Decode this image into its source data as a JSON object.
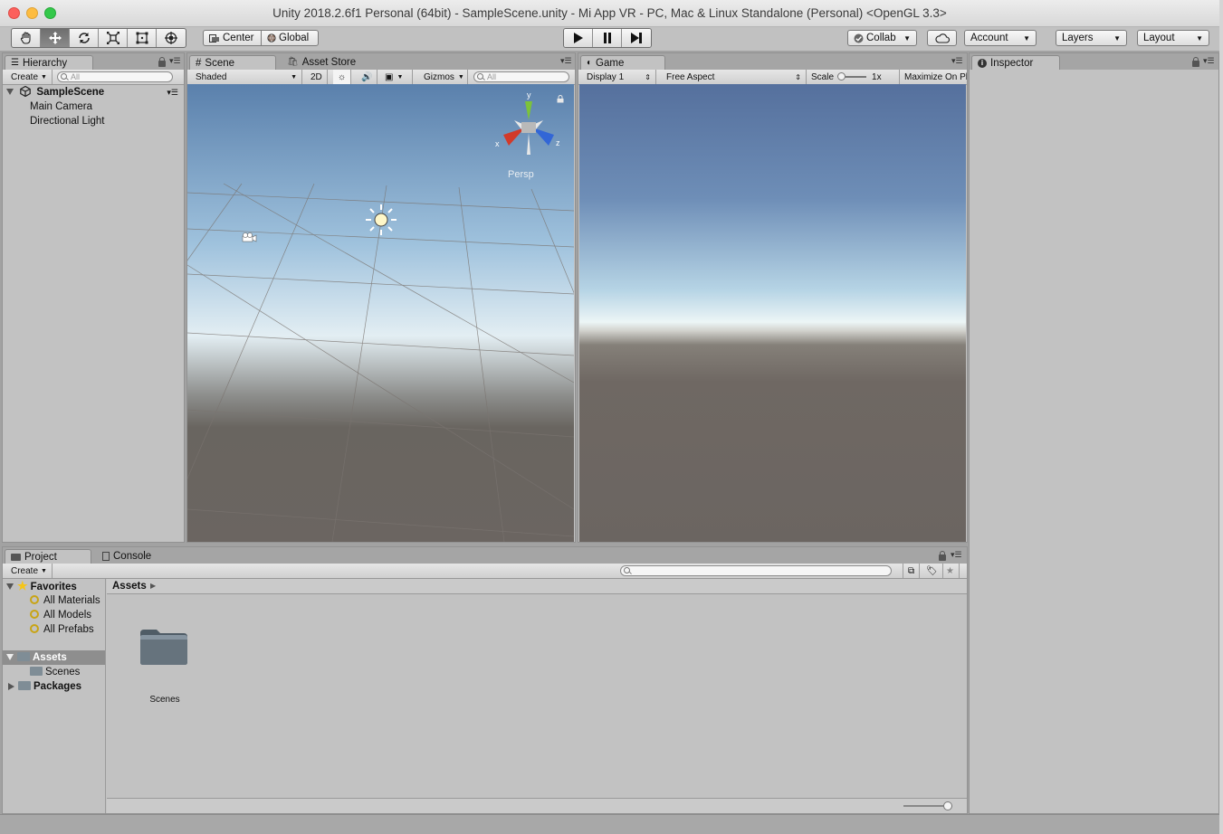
{
  "window": {
    "title": "Unity 2018.2.6f1 Personal (64bit) - SampleScene.unity - Mi App VR - PC, Mac & Linux Standalone (Personal) <OpenGL 3.3>"
  },
  "toolbar": {
    "tools": [
      "hand-tool",
      "move-tool",
      "rotate-tool",
      "scale-tool",
      "rect-tool",
      "transform-tool"
    ],
    "active_tool": "move-tool",
    "pivot_label": "Center",
    "space_label": "Global",
    "collab_label": "Collab",
    "account_label": "Account",
    "layers_label": "Layers",
    "layout_label": "Layout"
  },
  "hierarchy": {
    "tab_label": "Hierarchy",
    "create_label": "Create",
    "search_placeholder": "All",
    "scene_name": "SampleScene",
    "objects": [
      "Main Camera",
      "Directional Light"
    ]
  },
  "scene": {
    "tab_label": "Scene",
    "asset_store_label": "Asset Store",
    "shading_mode": "Shaded",
    "mode_2d": "2D",
    "gizmos_label": "Gizmos",
    "search_placeholder": "All",
    "gizmo_axes": {
      "x": "x",
      "y": "y",
      "z": "z"
    },
    "persp_label": "Persp"
  },
  "game": {
    "tab_label": "Game",
    "display_label": "Display 1",
    "aspect_label": "Free Aspect",
    "scale_label": "Scale",
    "scale_value": "1x",
    "maximize_label": "Maximize On Pl"
  },
  "inspector": {
    "tab_label": "Inspector"
  },
  "project": {
    "tab_label": "Project",
    "console_label": "Console",
    "create_label": "Create",
    "favorites_label": "Favorites",
    "favorites": [
      "All Materials",
      "All Models",
      "All Prefabs"
    ],
    "assets_label": "Assets",
    "asset_children": [
      "Scenes"
    ],
    "packages_label": "Packages",
    "breadcrumb": "Assets",
    "grid_items": [
      {
        "name": "Scenes",
        "icon": "folder-icon"
      }
    ]
  },
  "colors": {
    "editor_bg": "#c2c2c2",
    "selection": "#8e8e8e",
    "axis_x": "#d23a2a",
    "axis_y": "#7cc33a",
    "axis_z": "#3266d6"
  }
}
